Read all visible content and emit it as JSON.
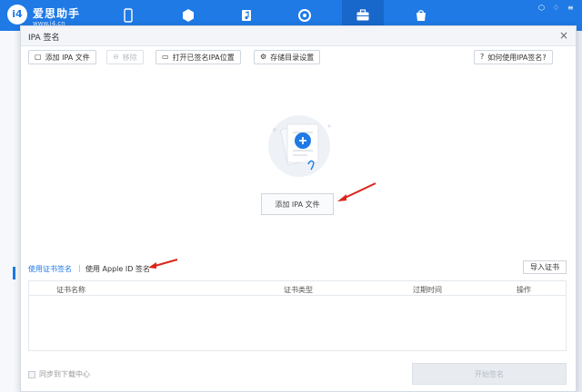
{
  "app": {
    "brand_name": "爱思助手",
    "brand_url": "www.i4.cn",
    "logo_text": "i4",
    "nav_icons": [
      "phone-icon",
      "box-icon",
      "music-icon",
      "sync-icon",
      "toolbox-icon",
      "bag-icon"
    ]
  },
  "dialog": {
    "title": "IPA 签名",
    "close_label": "×"
  },
  "toolbar": {
    "add_ipa": "添加 IPA 文件",
    "remove": "移除",
    "open_signed": "打开已签名IPA位置",
    "storage_settings": "存储目录设置",
    "help": "如何使用IPA签名?"
  },
  "center": {
    "add_button": "添加 IPA 文件"
  },
  "tabs": {
    "cert_sign": "使用证书签名",
    "separator": "|",
    "apple_id_sign": "使用 Apple ID 签名",
    "import_cert": "导入证书"
  },
  "table": {
    "headers": [
      "证书名称",
      "证书类型",
      "过期时间",
      "操作"
    ]
  },
  "footer": {
    "sync_label": "同步到下载中心",
    "start_sign": "开始签名"
  },
  "colors": {
    "accent": "#1f7ae6",
    "arrow": "#d9261c"
  }
}
